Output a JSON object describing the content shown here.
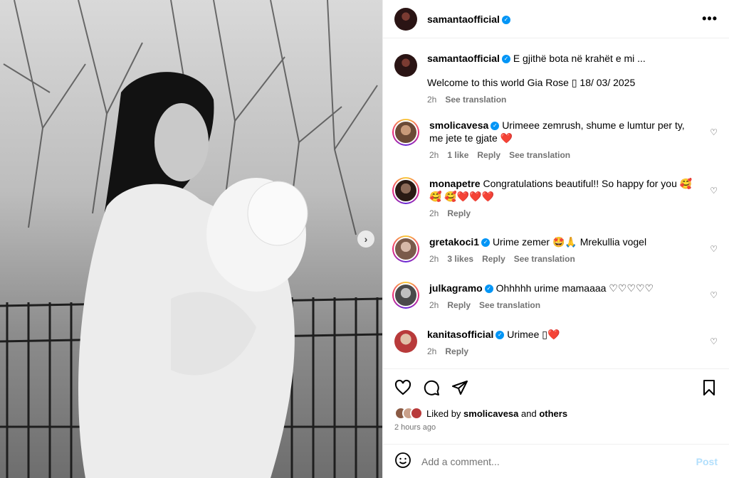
{
  "post": {
    "username": "samantaofficial",
    "verified_mark": "✓",
    "more_label": "•••",
    "next_label": "›"
  },
  "caption": {
    "username": "samantaofficial",
    "line1": "E gjithë bota në krahët e mi ...",
    "line2": "Welcome to this world Gia Rose ▯ 18/ 03/ 2025",
    "time": "2h",
    "translate": "See translation"
  },
  "comments": [
    {
      "username": "smolicavesa",
      "verified": true,
      "text": "Urimeee zemrush, shume e lumtur per ty, me jete te gjate",
      "emoji": "❤️",
      "time": "2h",
      "likes": "1 like",
      "reply": "Reply",
      "translate": "See translation"
    },
    {
      "username": "monapetre",
      "verified": false,
      "text": "Congratulations beautiful!! So happy for you 🥰🥰",
      "emoji": "🥰❤️❤️❤️",
      "time": "2h",
      "likes": "",
      "reply": "Reply",
      "translate": ""
    },
    {
      "username": "gretakoci1",
      "verified": true,
      "text": "Urime zemer 🤩🙏 Mrekullia vogel",
      "emoji": "",
      "time": "2h",
      "likes": "3 likes",
      "reply": "Reply",
      "translate": "See translation"
    },
    {
      "username": "julkagramo",
      "verified": true,
      "text": "Ohhhhh urime mamaaaa ♡♡♡♡♡",
      "emoji": "",
      "time": "2h",
      "likes": "",
      "reply": "Reply",
      "translate": "See translation"
    },
    {
      "username": "kanitasofficial",
      "verified": true,
      "text": "Urimee ▯",
      "emoji": "❤️",
      "time": "2h",
      "likes": "",
      "reply": "Reply",
      "translate": ""
    }
  ],
  "likes": {
    "prefix": "Liked by",
    "user": "smolicavesa",
    "conj": "and",
    "others": "others",
    "time_ago": "2 hours ago"
  },
  "composer": {
    "placeholder": "Add a comment...",
    "post_label": "Post"
  },
  "icons": [
    "heart-icon",
    "comment-icon",
    "share-icon",
    "bookmark-icon",
    "emoji-icon",
    "verified-icon",
    "more-icon",
    "chevron-right-icon"
  ],
  "colors": {
    "verified": "#0095f6",
    "muted": "#737373",
    "post_disabled": "#b2dffc",
    "heart": "#ed1c24"
  }
}
